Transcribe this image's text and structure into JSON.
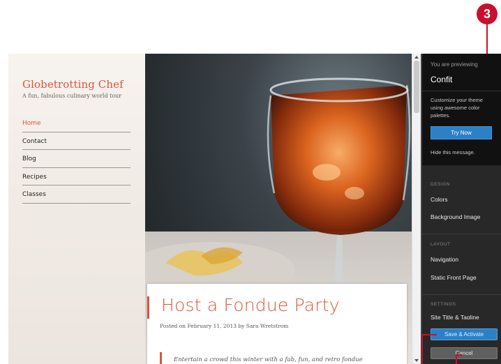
{
  "site": {
    "title": "Globetrotting Chef",
    "tagline": "A fun, fabulous culinary world tour",
    "nav": [
      "Home",
      "Contact",
      "Blog",
      "Recipes",
      "Classes"
    ],
    "post": {
      "title": "Host a Fondue Party",
      "meta": "Posted on February 11, 2013 by Sara Wretstrom",
      "excerpt": "Entertain a crowd this winter with a fab, fun, and retro fondue"
    }
  },
  "panel": {
    "previewing_label": "You are previewing",
    "theme_name": "Confit",
    "promo_text": "Customize your theme using awesome color palettes.",
    "try_now": "Try Now",
    "hide_message": "Hide this message.",
    "sections": {
      "design": {
        "heading": "DESIGN",
        "items": [
          "Colors",
          "Background Image"
        ]
      },
      "layout": {
        "heading": "LAYOUT",
        "items": [
          "Navigation",
          "Static Front Page"
        ]
      },
      "settings": {
        "heading": "SETTINGS",
        "items": [
          "Site Title & Tagline"
        ]
      }
    },
    "save_activate": "Save & Activate",
    "cancel": "Cancel"
  },
  "callout": {
    "number": "3"
  },
  "colors": {
    "accent": "#d9573a",
    "button_blue": "#2b80c6",
    "callout_red": "#c8102e",
    "panel_bg": "#282828"
  },
  "icons": [
    "scroll-up-arrow-icon",
    "scroll-down-arrow-icon"
  ]
}
